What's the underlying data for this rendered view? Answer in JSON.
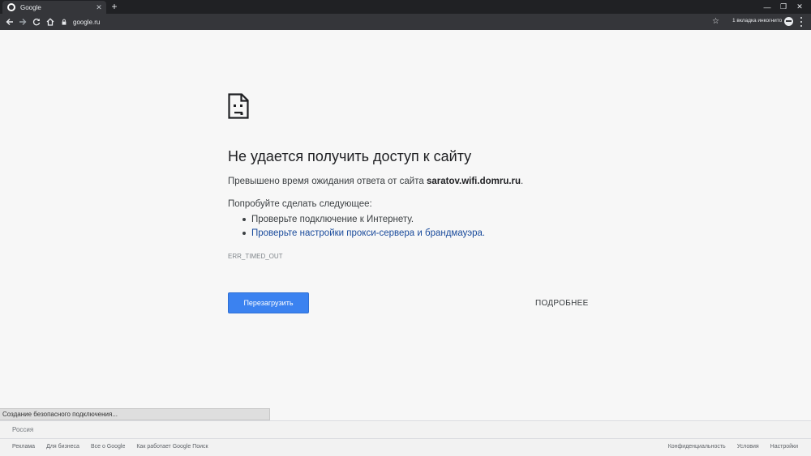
{
  "browser": {
    "tab": {
      "title": "Google",
      "close": "✕"
    },
    "new_tab": "+",
    "window_controls": {
      "minimize": "—",
      "maximize": "❐",
      "close": "✕"
    },
    "address": "google.ru",
    "incognito": "1 вкладка инкогнито"
  },
  "error": {
    "title": "Не удается получить доступ к сайту",
    "subtitle_prefix": "Превышено время ожидания ответа от сайта ",
    "subtitle_host": "saratov.wifi.domru.ru",
    "subtitle_suffix": ".",
    "try_label": "Попробуйте сделать следующее:",
    "suggestions": [
      "Проверьте подключение к Интернету.",
      "Проверьте настройки прокси-сервера и брандмауэра."
    ],
    "code": "ERR_TIMED_OUT",
    "reload_label": "Перезагрузить",
    "details_label": "ПОДРОБНЕЕ"
  },
  "status_bar": "Создание безопасного подключения...",
  "footer": {
    "region": "Россия",
    "left_links": [
      "Реклама",
      "Для бизнеса",
      "Все о Google",
      "Как работает Google Поиск"
    ],
    "right_links": [
      "Конфиденциальность",
      "Условия",
      "Настройки"
    ]
  },
  "colors": {
    "reload_button": "#3b82f0",
    "link": "#1a4b9c",
    "chrome_dark": "#202124",
    "toolbar": "#35363a"
  }
}
